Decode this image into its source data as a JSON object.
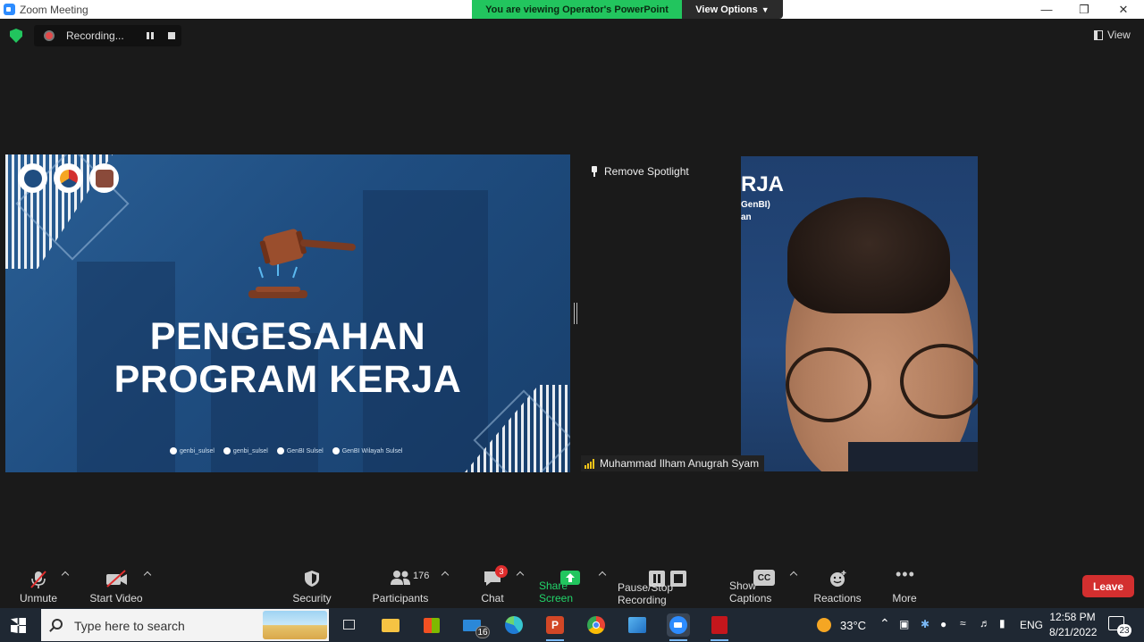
{
  "window": {
    "title": "Zoom Meeting",
    "share_banner": "You are viewing Operator's PowerPoint",
    "view_options": "View Options"
  },
  "topbar": {
    "recording": "Recording...",
    "view": "View"
  },
  "slide": {
    "title_line1": "PENGESAHAN",
    "title_line2": "PROGRAM KERJA",
    "socials": [
      "genbi_sulsel",
      "genbi_sulsel",
      "GenBI Sulsel",
      "GenBI Wilayah Sulsel"
    ]
  },
  "video": {
    "remove_spotlight": "Remove Spotlight",
    "participant_name": "Muhammad Ilham Anugrah Syam",
    "bg_text_1": "RJA",
    "bg_text_2": "GenBI)",
    "bg_text_3": "an"
  },
  "toolbar": {
    "unmute": "Unmute",
    "start_video": "Start Video",
    "security": "Security",
    "participants": "Participants",
    "participants_count": "176",
    "chat": "Chat",
    "chat_badge": "3",
    "share_screen": "Share Screen",
    "pause_stop": "Pause/Stop Recording",
    "show_captions": "Show Captions",
    "captions_icon": "CC",
    "reactions": "Reactions",
    "more": "More",
    "leave": "Leave"
  },
  "taskbar": {
    "search_placeholder": "Type here to search",
    "mail_badge": "16",
    "temperature": "33°C",
    "language": "ENG",
    "time": "12:58 PM",
    "date": "8/21/2022",
    "notifications": "23"
  },
  "colors": {
    "share_green": "#22c55e",
    "leave_red": "#d32f2f",
    "slide_blue": "#1f4d80"
  }
}
